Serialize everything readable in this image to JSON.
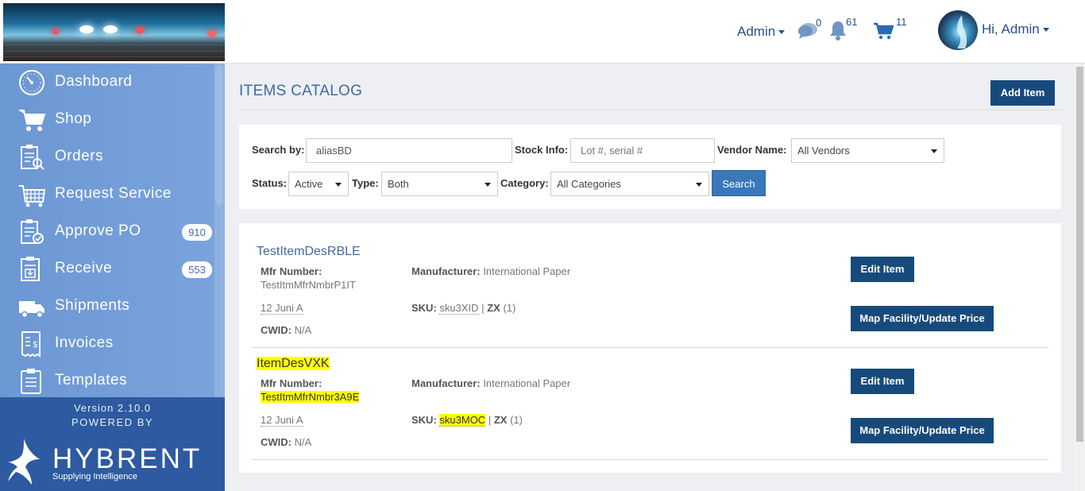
{
  "header": {
    "admin_menu_label": "Admin",
    "messages_count": "0",
    "notifications_count": "61",
    "cart_count": "11",
    "user_greeting": "Hi, Admin"
  },
  "sidebar": {
    "items": [
      {
        "label": "Dashboard",
        "icon": "dashboard-icon"
      },
      {
        "label": "Shop",
        "icon": "cart-icon"
      },
      {
        "label": "Orders",
        "icon": "orders-icon"
      },
      {
        "label": "Request Service",
        "icon": "request-service-icon"
      },
      {
        "label": "Approve PO",
        "icon": "approve-po-icon",
        "badge": "910"
      },
      {
        "label": "Receive",
        "icon": "receive-icon",
        "badge": "553"
      },
      {
        "label": "Shipments",
        "icon": "truck-icon"
      },
      {
        "label": "Invoices",
        "icon": "invoice-icon"
      },
      {
        "label": "Templates",
        "icon": "templates-icon"
      }
    ],
    "version": "Version 2.10.0",
    "powered_by": "POWERED BY",
    "brand": "HYBRENT",
    "tagline": "Supplying Intelligence"
  },
  "page": {
    "title": "ITEMS CATALOG",
    "add_item_label": "Add Item"
  },
  "search": {
    "search_by_label": "Search by:",
    "search_by_value": "aliasBD",
    "stock_info_label": "Stock Info:",
    "stock_info_placeholder": "Lot #, serial #",
    "vendor_label": "Vendor Name:",
    "vendor_value": "All Vendors",
    "status_label": "Status:",
    "status_value": "Active",
    "type_label": "Type:",
    "type_value": "Both",
    "category_label": "Category:",
    "category_value": "All Categories",
    "search_button": "Search"
  },
  "items": [
    {
      "title": "TestItemDesRBLE",
      "mfr_number_label": "Mfr Number:",
      "mfr_number": "TestItmMfrNmbrP1IT",
      "manufacturer_label": "Manufacturer:",
      "manufacturer": "International Paper",
      "unit": "12 Juni A",
      "sku_label": "SKU:",
      "sku": "sku3XID",
      "sep": "|",
      "uom_code": "ZX",
      "uom_qty": "(1)",
      "cwid_label": "CWID:",
      "cwid": "N/A",
      "edit_label": "Edit Item",
      "map_label": "Map Facility/Update Price",
      "highlighted": false
    },
    {
      "title": "ItemDesVXK",
      "mfr_number_label": "Mfr Number:",
      "mfr_number": "TestItmMfrNmbr3A9E",
      "manufacturer_label": "Manufacturer:",
      "manufacturer": "International Paper",
      "unit": "12 Juni A",
      "sku_label": "SKU:",
      "sku": "sku3MOC",
      "sep": "|",
      "uom_code": "ZX",
      "uom_qty": "(1)",
      "cwid_label": "CWID:",
      "cwid": "N/A",
      "edit_label": "Edit Item",
      "map_label": "Map Facility/Update Price",
      "highlighted": true
    }
  ],
  "colors": {
    "primary_button": "#174a7c",
    "search_button": "#3a77bb",
    "sidebar": "#6b97d3",
    "sidebar_footer": "#2d5aa0",
    "highlight": "#ffff00",
    "link": "#3f6aa5"
  }
}
